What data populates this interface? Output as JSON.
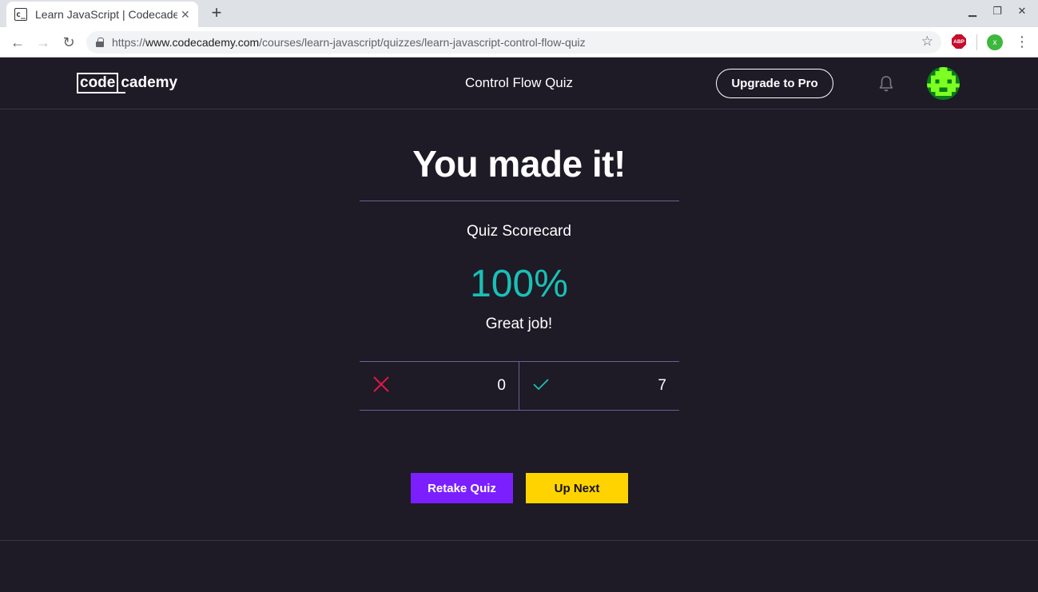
{
  "browser": {
    "tab_title": "Learn JavaScript | Codecademy",
    "tab_favicon": "c_",
    "new_tab": "+",
    "url_scheme": "https://",
    "url_host": "www.codecademy.com",
    "url_path": "/courses/learn-javascript/quizzes/learn-javascript-control-flow-quiz",
    "abp_label": "ABP",
    "extension_label": "x"
  },
  "header": {
    "logo_box": "code",
    "logo_rest": "cademy",
    "title": "Control Flow Quiz",
    "upgrade_label": "Upgrade to Pro"
  },
  "result": {
    "headline": "You made it!",
    "scorecard_label": "Quiz Scorecard",
    "score": "100%",
    "message": "Great job!",
    "incorrect_count": "0",
    "correct_count": "7"
  },
  "actions": {
    "retake_label": "Retake Quiz",
    "next_label": "Up Next"
  },
  "colors": {
    "background": "#1e1a26",
    "score": "#19c0b5",
    "retake_button": "#7b1fff",
    "next_button": "#ffd300",
    "incorrect_icon": "#e0164a",
    "correct_icon": "#19c0b5",
    "divider": "#6c5f96"
  }
}
